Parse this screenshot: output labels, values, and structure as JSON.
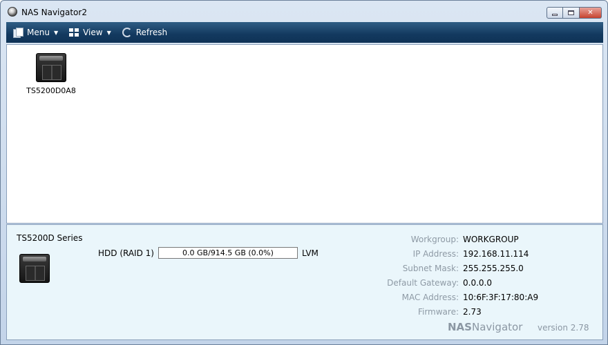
{
  "window": {
    "title": "NAS Navigator2"
  },
  "toolbar": {
    "menu_label": "Menu",
    "view_label": "View",
    "refresh_label": "Refresh"
  },
  "devices": [
    {
      "name": "TS5200D0A8",
      "icon": "nas-device-icon"
    }
  ],
  "details": {
    "series": "TS5200D Series",
    "hdd_label": "HDD (RAID 1)",
    "hdd_usage_text": "0.0 GB/914.5 GB (0.0%)",
    "hdd_usage_fraction": 0.0,
    "volume_type": "LVM",
    "info": [
      {
        "label": "Workgroup:",
        "value": "WORKGROUP"
      },
      {
        "label": "IP Address:",
        "value": "192.168.11.114"
      },
      {
        "label": "Subnet Mask:",
        "value": "255.255.255.0"
      },
      {
        "label": "Default Gateway:",
        "value": "0.0.0.0"
      },
      {
        "label": "MAC Address:",
        "value": "10:6F:3F:17:80:A9"
      },
      {
        "label": "Firmware:",
        "value": "2.73"
      }
    ],
    "brand_nas": "NAS",
    "brand_navigator": "Navigator",
    "version": "version 2.78"
  },
  "colors": {
    "toolbar": "#13395f",
    "details_bg": "#eaf6fb",
    "close_button": "#c7432f"
  }
}
